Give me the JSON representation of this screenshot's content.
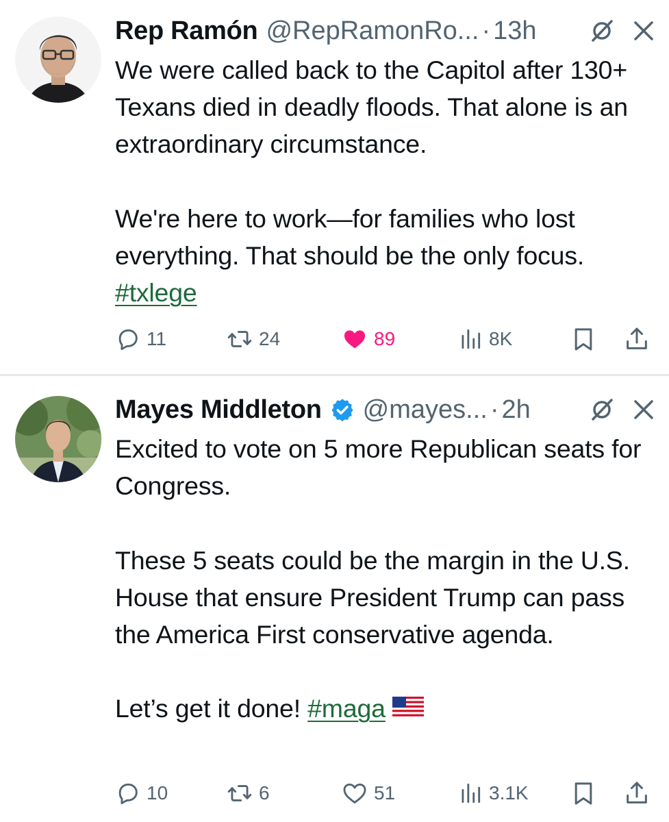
{
  "tweets": [
    {
      "display_name": "Rep Ramón",
      "handle": "@RepRamonRo...",
      "separator": "·",
      "time": "13h",
      "verified": false,
      "paragraphs": [
        "We were called back to the Capitol after 130+ Texans died in deadly floods. That alone is an extraordinary circumstance.",
        "We're here to work—for families who lost everything. That should be the only focus."
      ],
      "hashtag_line": "#txlege",
      "replies": "11",
      "reposts": "24",
      "likes": "89",
      "liked": true,
      "views": "8K"
    },
    {
      "display_name": "Mayes Middleton",
      "handle": "@mayes...",
      "separator": "·",
      "time": "2h",
      "verified": true,
      "paragraphs": [
        "Excited to vote on 5 more Republican seats for Congress.",
        "These 5 seats could be the margin in the U.S. House that ensure President Trump can pass the America First conservative agenda."
      ],
      "closing_text": "Let’s get it done! ",
      "closing_hashtag": "#maga",
      "closing_emoji": "us-flag-emoji",
      "replies": "10",
      "reposts": "6",
      "likes": "51",
      "liked": false,
      "views": "3.1K"
    }
  ],
  "colors": {
    "text": "#0f1419",
    "secondary": "#536471",
    "hashtag": "#1d6b3a",
    "like_pink": "#f91880",
    "verified_blue": "#1d9bf0",
    "divider": "#e6e9eb"
  },
  "icons": [
    "reply-icon",
    "repost-icon",
    "like-icon",
    "views-icon",
    "bookmark-icon",
    "share-icon",
    "grok-icon",
    "close-icon",
    "verified-badge-icon"
  ]
}
